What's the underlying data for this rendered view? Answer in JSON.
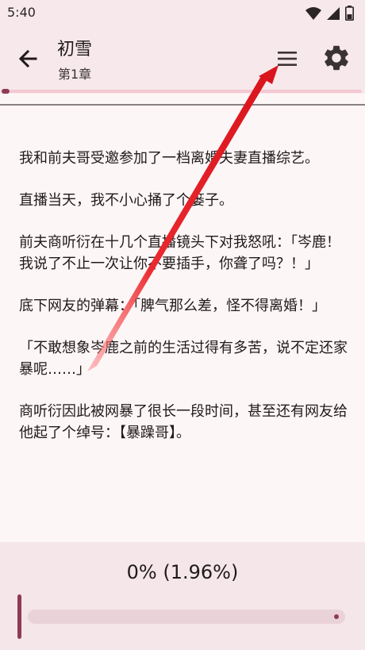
{
  "status_bar": {
    "time": "5:40",
    "icons": [
      "wifi-icon",
      "signal-icon",
      "battery-icon"
    ]
  },
  "app_bar": {
    "back_icon": "arrow-back-icon",
    "title": "初雪",
    "subtitle": "第1章",
    "menu_icon": "menu-icon",
    "settings_icon": "gear-icon"
  },
  "content": {
    "paragraphs": [
      "我和前夫哥受邀参加了一档离婚夫妻直播综艺。",
      "直播当天，我不小心捅了个篓子。",
      "前夫商听衍在十几个直播镜头下对我怒吼：「岑鹿！我说了不止一次让你不要插手，你聋了吗？！」",
      "底下网友的弹幕：「脾气那么差，怪不得离婚！」",
      "「不敢想象岑鹿之前的生活过得有多苦，说不定还家暴呢……」",
      "商听衍因此被网暴了很长一段时间，甚至还有网友给他起了个绰号：【暴躁哥】。"
    ]
  },
  "progress": {
    "label": "0% (1.96%)",
    "value_percent": 0
  },
  "colors": {
    "accent": "#8e3b54",
    "app_bar_bg": "#f7e8eb",
    "page_bg": "#fdf6f7",
    "annotation_arrow": "#e8202a"
  }
}
